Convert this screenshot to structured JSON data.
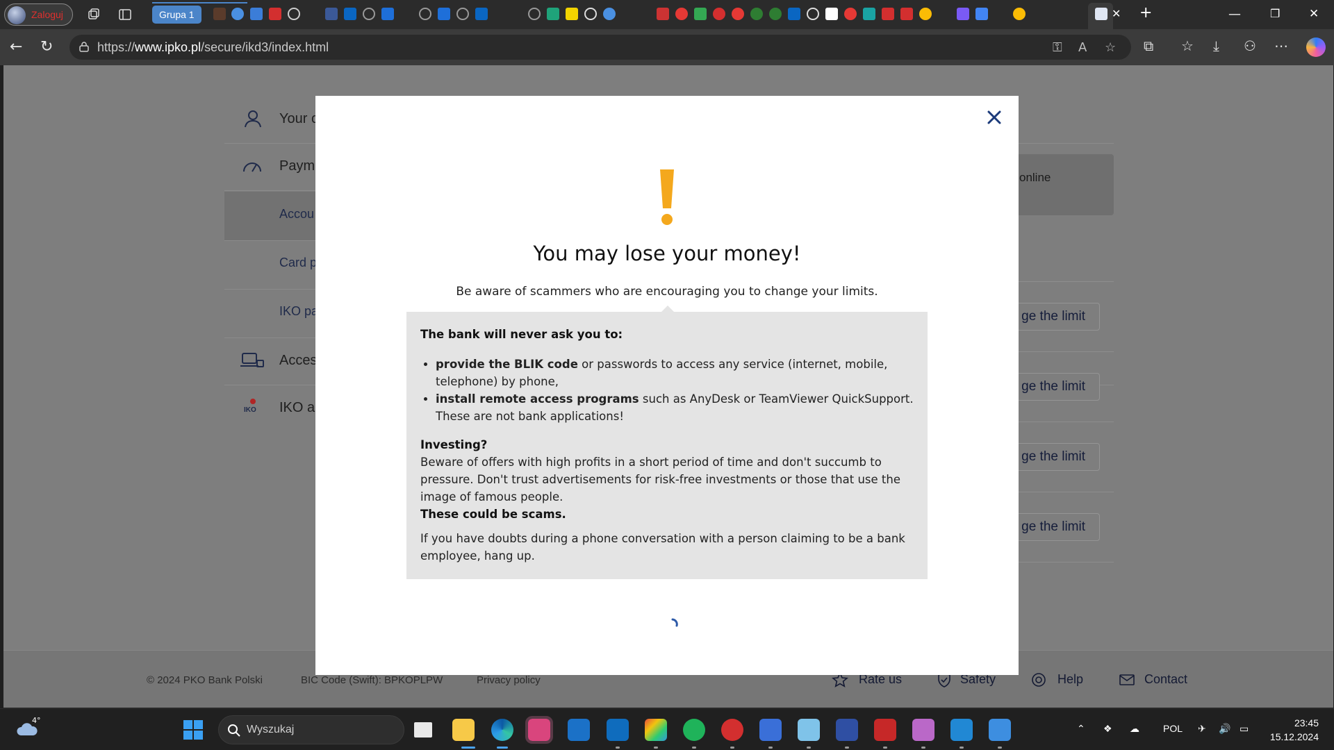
{
  "browser": {
    "profile_label": "Zaloguj",
    "tab_group": "Grupa 1",
    "url_prefix": "https://",
    "url_domain": "www.ipko.pl",
    "url_path": "/secure/ikd3/index.html"
  },
  "background": {
    "sidebar": [
      {
        "label": "Your c",
        "icon": "user-icon"
      },
      {
        "label": "Paym",
        "icon": "gauge-icon"
      },
      {
        "label": "Accou",
        "sub": true
      },
      {
        "label": "Card p",
        "sub": true
      },
      {
        "label": "IKO pa",
        "sub": true
      },
      {
        "label": "Acces",
        "icon": "laptop-lock-icon"
      },
      {
        "label": "IKO a",
        "icon": "iko-icon"
      }
    ],
    "info_box_text": "online",
    "limit_buttons": [
      "ge the limit",
      "ge the limit",
      "ge the limit",
      "ge the limit"
    ],
    "iko_badge": "IKO"
  },
  "footer": {
    "copyright": "© 2024 PKO Bank Polski",
    "bic": "BIC Code (Swift): BPKOPLPW",
    "privacy": "Privacy policy",
    "links": [
      "Rate us",
      "Safety",
      "Help",
      "Contact"
    ]
  },
  "modal": {
    "title": "You may lose your money!",
    "subtitle": "Be aware of scammers who are encouraging you to change your limits.",
    "box_heading": "The bank will never ask you to:",
    "bullet1_bold": "provide the BLIK code",
    "bullet1_rest": " or passwords to access any service (internet, mobile, telephone) by phone,",
    "bullet2_bold": "install remote access programs",
    "bullet2_rest": " such as AnyDesk or TeamViewer QuickSupport. These are not bank applications!",
    "investing_heading": "Investing?",
    "investing_text": "Beware of offers with high profits in a short period of time and don't succumb to pressure. Don't trust advertisements for risk-free investments or those that use the image of famous people.",
    "scams_text": "These could be scams.",
    "doubts_text": "If you have doubts during a phone conversation with a person claiming to be a bank employee, hang up.",
    "accent_color": "#f4a81d"
  },
  "taskbar": {
    "weather": "4°",
    "search_placeholder": "Wyszukaj",
    "lang": "POL",
    "time": "23:45",
    "date": "15.12.2024"
  }
}
